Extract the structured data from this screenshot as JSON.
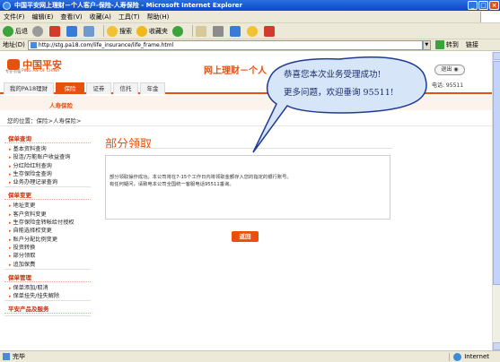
{
  "window": {
    "title": "中国平安网上理财－个人客户-保险-人寿保险 - Microsoft Internet Explorer",
    "minimize": "_",
    "maximize": "□",
    "close": "×"
  },
  "menubar": [
    "文件(F)",
    "编辑(E)",
    "查看(V)",
    "收藏(A)",
    "工具(T)",
    "帮助(H)"
  ],
  "toolbar": {
    "back": "后退",
    "search": "搜索",
    "favorites": "收藏夹"
  },
  "addressbar": {
    "label": "地址(D)",
    "url": "http://stg.pa18.com/life_insurance/life_frame.html",
    "go": "转到",
    "links": "链接"
  },
  "header": {
    "logo_cn": "中国平安",
    "logo_en": "PING AN OF CHINA",
    "slogan": "专业·价值",
    "site_title": "网上理财－个人",
    "logout": "退出",
    "hotline": "电话: 95511"
  },
  "nav": {
    "tabs": [
      {
        "label": "我的PA18理财"
      },
      {
        "label": "保险"
      },
      {
        "label": "证券"
      },
      {
        "label": "信托"
      },
      {
        "label": "年金"
      }
    ],
    "sub": "人寿保险"
  },
  "breadcrumb": "您的位置：保险>人寿保险>",
  "sidebar": {
    "sections": [
      {
        "title": "保单查询",
        "items": [
          "基本资料查询",
          "投连/万能账户收益查询",
          "分红险红利查询",
          "生存保险金查询",
          "业务办理记录查询"
        ]
      },
      {
        "title": "保单变更",
        "items": [
          "地址变更",
          "客户资料变更",
          "生存保险金转帐给付授权",
          "自能选择权变更",
          "账户分配比例变更",
          "投资转换",
          "部分领取",
          "追加保费"
        ]
      },
      {
        "title": "保单管理",
        "items": [
          "保单添加/取消",
          "保单挂失/挂失解除"
        ]
      },
      {
        "title": "平安产品及服务",
        "items": []
      }
    ]
  },
  "main": {
    "title": "部分领取",
    "message_lines": [
      "部分领取操作成功。本公司将在7-15个工作日内将领取金额存入您的指定的银行账号。",
      "有任何疑问，请致电本公司全国统一客服电话95511垂询。"
    ],
    "return_button": "返回"
  },
  "callout": {
    "line1": "恭喜您本次业务受理成功!",
    "line2": "更多问题，欢迎垂询 95511!"
  },
  "statusbar": {
    "status": "完毕",
    "zone": "Internet"
  },
  "colors": {
    "brand": "#e8500e",
    "callout_fill": "#d6e6f8",
    "callout_stroke": "#1f3a93"
  }
}
